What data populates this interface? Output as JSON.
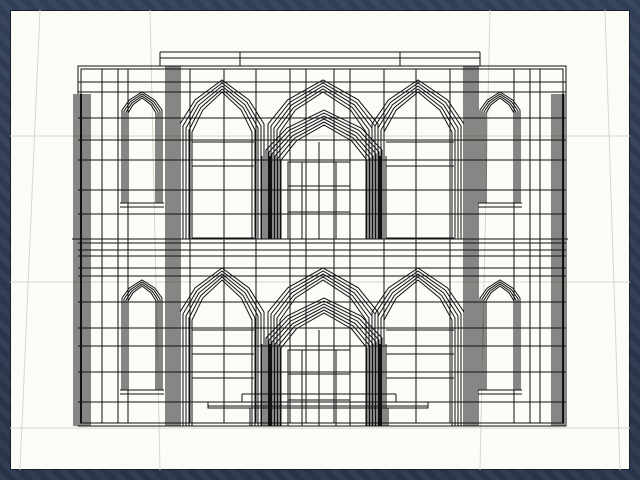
{
  "scene": {
    "subject": "wireframe-building-facade",
    "colors": {
      "frame": "#2f3b52",
      "viewport_bg": "#fbfbf8",
      "wire": "#111111",
      "guide": "#d8d6c6"
    },
    "stories": 2,
    "bays_per_story": 5
  }
}
